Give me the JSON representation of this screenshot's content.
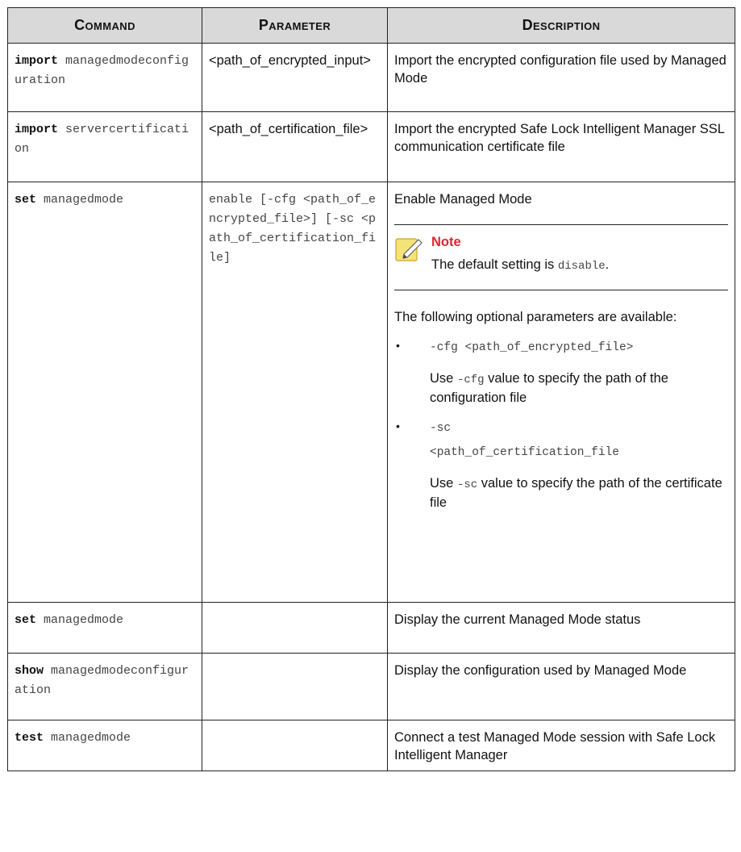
{
  "headers": {
    "command": "Command",
    "parameter": "Parameter",
    "description": "Description"
  },
  "rows": [
    {
      "cmd_kw": "import",
      "cmd_rest": "managedmodeconfiguration",
      "param": "<path_of_encrypted_input>",
      "desc": "Import the encrypted configuration file used by Managed Mode"
    },
    {
      "cmd_kw": "import",
      "cmd_rest": "servercertification",
      "param": "<path_of_certification_file>",
      "desc": "Import the encrypted Safe Lock Intelligent Manager SSL communication certificate file"
    },
    {
      "cmd_kw": "set",
      "cmd_rest": "managedmode",
      "param": "enable [-cfg <path_of_encrypted_file>] [-sc <path_of_certification_file]",
      "desc": "Enable Managed Mode",
      "note": {
        "title": "Note",
        "text_before": "The default setting is ",
        "code": "disable",
        "text_after": "."
      },
      "optional_intro": "The following optional parameters are available:",
      "bullets": [
        {
          "bullet": "•",
          "param_line1": "-cfg <path_of_encrypted_file>",
          "param_line2": "",
          "use": "Use ",
          "code": "-cfg",
          "rest": " value to specify the path of the configuration file"
        },
        {
          "bullet": "•",
          "param_line1": "-sc",
          "param_line2": "<path_of_certification_file",
          "use": "Use ",
          "code": "-sc",
          "rest": " value to specify the path of the certificate file"
        }
      ]
    },
    {
      "cmd_kw": "set",
      "cmd_rest": "managedmode",
      "param": "",
      "desc": "Display the current Managed Mode status"
    },
    {
      "cmd_kw": "show",
      "cmd_rest": "managedmodeconfiguration",
      "param": "",
      "desc": "Display the configuration used by Managed Mode"
    },
    {
      "cmd_kw": "test",
      "cmd_rest": "managedmode",
      "param": "",
      "desc": "Connect a test Managed Mode session with Safe Lock Intelligent Manager"
    }
  ]
}
